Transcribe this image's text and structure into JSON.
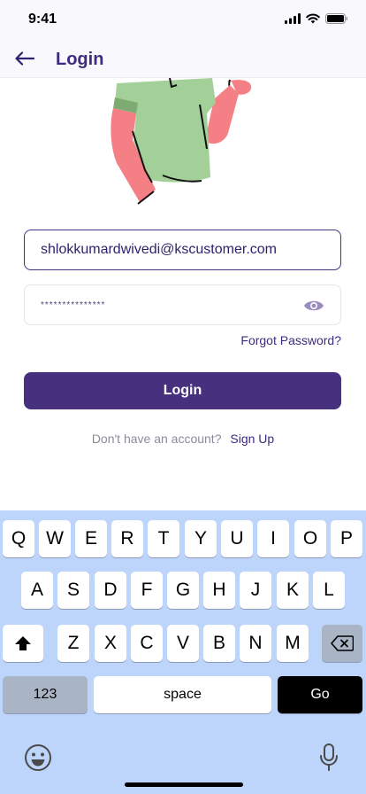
{
  "status_bar": {
    "time": "9:41",
    "icons": [
      "signal-icon",
      "wifi-icon",
      "battery-icon"
    ]
  },
  "nav": {
    "title": "Login",
    "back_icon": "arrow-left-icon"
  },
  "illustration": {
    "icon": "person-illustration"
  },
  "form": {
    "email_value": "shlokkumardwivedi@kscustomer.com",
    "password_value": "***************",
    "password_toggle_icon": "eye-icon",
    "forgot_label": "Forgot Password?",
    "login_label": "Login",
    "signup_prompt": "Don't have an account?",
    "signup_label": "Sign Up"
  },
  "keyboard": {
    "row1": [
      "Q",
      "W",
      "E",
      "R",
      "T",
      "Y",
      "U",
      "I",
      "O",
      "P"
    ],
    "row2": [
      "A",
      "S",
      "D",
      "F",
      "G",
      "H",
      "J",
      "K",
      "L"
    ],
    "row3": [
      "Z",
      "X",
      "C",
      "V",
      "B",
      "N",
      "M"
    ],
    "shift_icon": "shift-icon",
    "delete_icon": "delete-icon",
    "numbers_label": "123",
    "space_label": "space",
    "go_label": "Go",
    "emoji_icon": "emoji-icon",
    "mic_icon": "microphone-icon"
  },
  "colors": {
    "primary": "#47317f",
    "title": "#3f2b7e",
    "keyboard_bg": "#bdd5fb",
    "shirt": "#a3cf98",
    "skin": "#f47f85"
  }
}
